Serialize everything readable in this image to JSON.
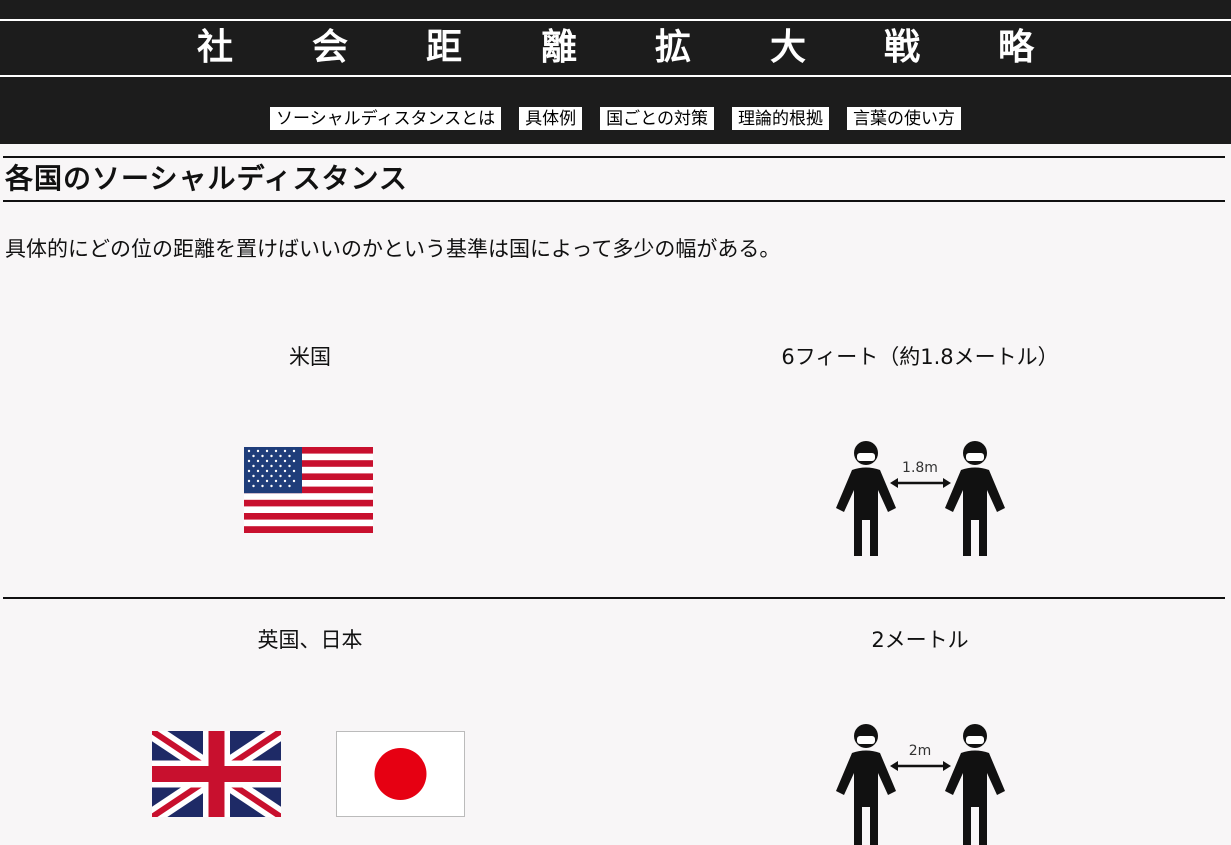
{
  "header": {
    "title_chars": [
      "社",
      "会",
      "距",
      "離",
      "拡",
      "大",
      "戦",
      "略"
    ]
  },
  "nav": {
    "items": [
      {
        "label": "ソーシャルディスタンスとは"
      },
      {
        "label": "具体例"
      },
      {
        "label": "国ごとの対策"
      },
      {
        "label": "理論的根拠"
      },
      {
        "label": "言葉の使い方"
      }
    ]
  },
  "section": {
    "title": "各国のソーシャルディスタンス",
    "intro": "具体的にどの位の距離を置けばいいのかという基準は国によって多少の幅がある。"
  },
  "rows": [
    {
      "country": "米国",
      "distance": "6フィート（約1.8メートル）",
      "figure_label": "1.8m",
      "flags": [
        "us-flag-icon"
      ]
    },
    {
      "country": "英国、日本",
      "distance": "2メートル",
      "figure_label": "2m",
      "flags": [
        "uk-flag-icon",
        "japan-flag-icon"
      ]
    }
  ],
  "colors": {
    "header_bg": "#1c1c1c",
    "page_bg": "#f8f6f7",
    "us_red": "#c8102e",
    "us_blue": "#1f3d7a",
    "uk_blue": "#1e2a66",
    "japan_red": "#e60012"
  }
}
